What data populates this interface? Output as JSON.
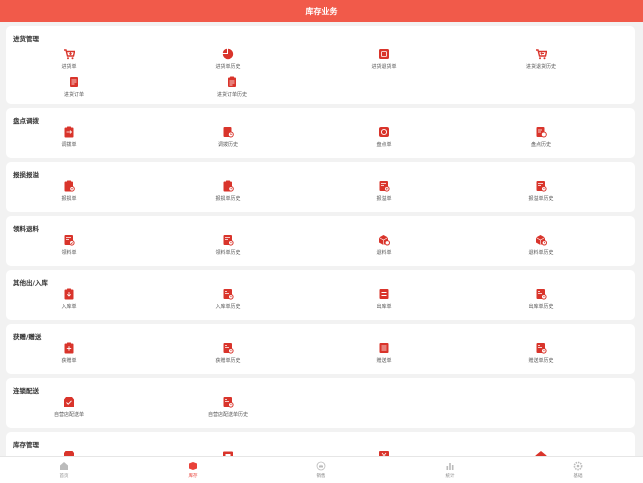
{
  "header": {
    "title": "库存业务"
  },
  "accent": "#d9342b",
  "sections": [
    {
      "title": "进货管理",
      "items": [
        {
          "label": "进货单",
          "icon": "cart-down-icon"
        },
        {
          "label": "进货单历史",
          "icon": "pie-chart-icon"
        },
        {
          "label": "进货退货单",
          "icon": "return-box-icon"
        },
        {
          "label": "进货退货历史",
          "icon": "cart-return-icon"
        },
        {
          "label": "进货订单",
          "icon": "order-doc-icon"
        },
        {
          "label": "进货订单历史",
          "icon": "order-history-icon"
        }
      ]
    },
    {
      "title": "盘点调拨",
      "items": [
        {
          "label": "调拨单",
          "icon": "transfer-clipboard-icon"
        },
        {
          "label": "调拨历史",
          "icon": "transfer-history-icon"
        },
        {
          "label": "盘点单",
          "icon": "stocktake-icon"
        },
        {
          "label": "盘点历史",
          "icon": "stocktake-history-icon"
        }
      ]
    },
    {
      "title": "报损报溢",
      "items": [
        {
          "label": "报损单",
          "icon": "loss-report-icon"
        },
        {
          "label": "报损单历史",
          "icon": "loss-history-icon"
        },
        {
          "label": "报溢单",
          "icon": "overflow-report-icon"
        },
        {
          "label": "报溢单历史",
          "icon": "overflow-history-icon"
        }
      ]
    },
    {
      "title": "领料退料",
      "items": [
        {
          "label": "领料单",
          "icon": "pick-doc-icon"
        },
        {
          "label": "领料单历史",
          "icon": "pick-history-icon"
        },
        {
          "label": "退料单",
          "icon": "return-material-icon"
        },
        {
          "label": "退料单历史",
          "icon": "return-material-history-icon"
        }
      ]
    },
    {
      "title": "其他出/入库",
      "items": [
        {
          "label": "入库单",
          "icon": "inbound-icon"
        },
        {
          "label": "入库单历史",
          "icon": "inbound-history-icon"
        },
        {
          "label": "出库单",
          "icon": "outbound-icon"
        },
        {
          "label": "出库单历史",
          "icon": "outbound-history-icon"
        }
      ]
    },
    {
      "title": "获赠/赠送",
      "items": [
        {
          "label": "获赠单",
          "icon": "gift-receive-icon"
        },
        {
          "label": "获赠单历史",
          "icon": "gift-receive-history-icon"
        },
        {
          "label": "赠送单",
          "icon": "gift-send-icon"
        },
        {
          "label": "赠送单历史",
          "icon": "gift-send-history-icon"
        }
      ]
    },
    {
      "title": "连锁配送",
      "items": [
        {
          "label": "自营店配送单",
          "icon": "delivery-check-icon"
        },
        {
          "label": "自营店配送单历史",
          "icon": "delivery-history-icon"
        }
      ]
    },
    {
      "title": "库存管理",
      "items": [
        {
          "label": "",
          "icon": "box-icon"
        },
        {
          "label": "",
          "icon": "picture-icon"
        },
        {
          "label": "",
          "icon": "yen-icon"
        },
        {
          "label": "",
          "icon": "warehouse-icon"
        }
      ]
    }
  ],
  "tabs": [
    {
      "label": "首页",
      "icon": "home-icon",
      "active": false
    },
    {
      "label": "库存",
      "icon": "inventory-box-icon",
      "active": true
    },
    {
      "label": "销售",
      "icon": "crown-icon",
      "active": false
    },
    {
      "label": "统计",
      "icon": "bar-chart-icon",
      "active": false
    },
    {
      "label": "基础",
      "icon": "settings-icon",
      "active": false
    }
  ]
}
